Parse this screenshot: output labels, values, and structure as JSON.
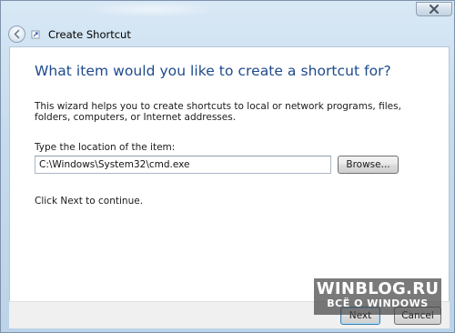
{
  "window": {
    "title": "Create Shortcut",
    "close_icon": "close-x-icon",
    "back_icon": "back-arrow-icon",
    "wizard_icon": "shortcut-wizard-icon"
  },
  "wizard": {
    "heading": "What item would you like to create a shortcut for?",
    "description": "This wizard helps you to create shortcuts to local or network programs, files, folders, computers, or Internet addresses.",
    "location_label": "Type the location of the item:",
    "location_value": "C:\\Windows\\System32\\cmd.exe",
    "browse_label": "Browse...",
    "continue_hint": "Click Next to continue."
  },
  "footer": {
    "next_label": "Next",
    "cancel_label": "Cancel"
  },
  "watermark": {
    "main": "WINBLOG.RU",
    "sub": "ВСЁ О WINDOWS"
  },
  "colors": {
    "heading": "#1e4a8c",
    "frame": "#c6dbee",
    "content_bg": "#ffffff"
  }
}
